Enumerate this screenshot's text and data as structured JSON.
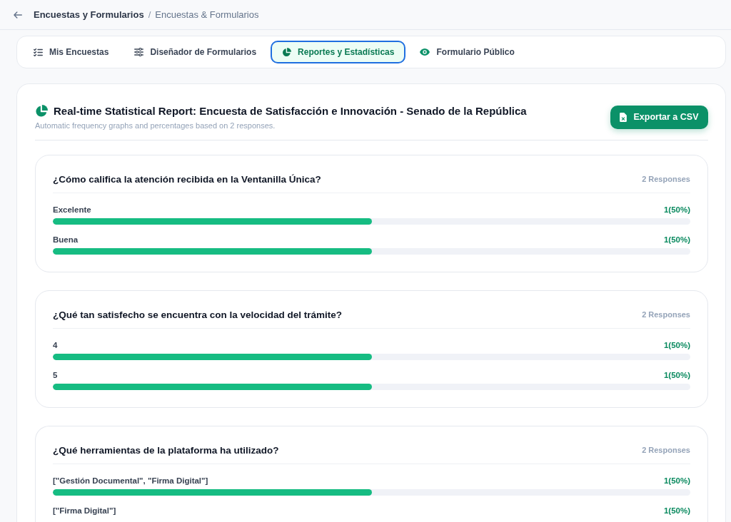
{
  "header": {
    "title": "Encuestas y Formularios",
    "separator": "/",
    "breadcrumb": "Encuestas & Formularios"
  },
  "tabs": [
    {
      "label": "Mis Encuestas",
      "selected": false
    },
    {
      "label": "Diseñador de Formularios",
      "selected": false
    },
    {
      "label": "Reportes y Estadísticas",
      "selected": true
    },
    {
      "label": "Formulario Público",
      "selected": false
    }
  ],
  "report": {
    "title": "Real-time Statistical Report: Encuesta de Satisfacción e Innovación - Senado de la República",
    "subtitle": "Automatic frequency graphs and percentages based on 2 responses.",
    "export_button": "Exportar a CSV"
  },
  "questions": [
    {
      "title": "¿Cómo califica la atención recibida en la Ventanilla Única?",
      "responses": "2 Responses",
      "options": [
        {
          "label": "Excelente",
          "count": "1(50%)",
          "level": 0.5
        },
        {
          "label": "Buena",
          "count": "1(50%)",
          "level": 0.5
        }
      ]
    },
    {
      "title": "¿Qué tan satisfecho se encuentra con la velocidad del trámite?",
      "responses": "2 Responses",
      "options": [
        {
          "label": "4",
          "count": "1(50%)",
          "level": 0.5
        },
        {
          "label": "5",
          "count": "1(50%)",
          "level": 0.5
        }
      ]
    },
    {
      "title": "¿Qué herramientas de la plataforma ha utilizado?",
      "responses": "2 Responses",
      "options": [
        {
          "label": "[\"Gestión Documental\", \"Firma Digital\"]",
          "count": "1(50%)",
          "level": 0.5
        },
        {
          "label": "[\"Firma Digital\"]",
          "count": "1(50%)"
        }
      ]
    }
  ]
}
